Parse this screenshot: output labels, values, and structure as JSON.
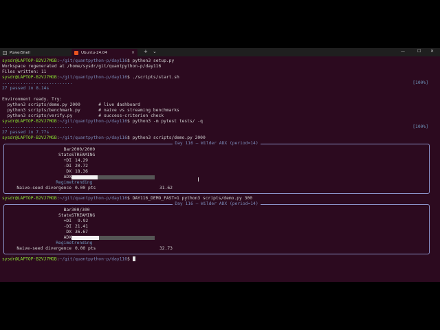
{
  "tabs": [
    {
      "label": "PowerShell",
      "active": false
    },
    {
      "label": "Ubuntu-24.04",
      "active": true
    }
  ],
  "tab_controls": {
    "close": "×",
    "new": "+",
    "menu": "⌄"
  },
  "window_controls": {
    "minimize": "—",
    "maximize": "☐",
    "close": "✕"
  },
  "prompt": {
    "user": "sysdr@LAPTOP-B2VJ7MGB",
    "sep": ":",
    "path": "~/git/quantpython-p/day116",
    "dollar": "$"
  },
  "lines": {
    "cmd1": "python3 setup.py",
    "out1": "Workspace regenerated at /home/sysdr/git/quantpython-p/day116",
    "out2": "Files written: 11",
    "cmd2": "./scripts/start.sh",
    "dots1": "...........................",
    "pct1": "[100%]",
    "pass1": "27 passed in 8.14s",
    "ready": "Environment ready. Try:",
    "try1": "  python3 scripts/demo.py 2000       # live dashboard",
    "try2": "  python3 scripts/benchmark.py       # naive vs streaming benchmarks",
    "try3": "  python3 scripts/verify.py          # success-criterion check",
    "cmd3": "python3 -m pytest tests/ -q",
    "dots2": "...........................",
    "pct2": "[100%]",
    "pass2": "27 passed in 7.77s",
    "cmd4": "python3 scripts/demo.py 2000",
    "cmd5": "DAY116_DEMO_FAST=1 python3 scripts/demo.py 300"
  },
  "panel1": {
    "title": "Day 116 — Wilder ADX (period=14)",
    "labels": {
      "bar": "Bar",
      "state": "State",
      "pdi": "+DI",
      "mdi": "-DI",
      "dx": "DX",
      "adx": "ADX",
      "regime": "Regime",
      "div": "Naive-seed divergence"
    },
    "bar": "2000/2000",
    "state": "STREAMING",
    "pdi": "14.29",
    "mdi": "20.72",
    "dx": "18.36",
    "adx": "31.62",
    "adx_fraction": 0.3162,
    "regime": "trending",
    "div": "0.00 pts"
  },
  "panel2": {
    "title": "Day 116 — Wilder ADX (period=14)",
    "labels": {
      "bar": "Bar",
      "state": "State",
      "pdi": "+DI",
      "mdi": "-DI",
      "dx": "DX",
      "adx": "ADX",
      "regime": "Regime",
      "div": "Naive-seed divergence"
    },
    "bar": "300/300",
    "state": "STREAMING",
    "pdi": "9.92",
    "mdi": "21.41",
    "dx": "36.67",
    "adx": "32.73",
    "adx_fraction": 0.3273,
    "regime": "trending",
    "div": "0.00 pts"
  },
  "colors": {
    "bg": "#2c0a1f",
    "prompt_user": "#8ae234",
    "prompt_path": "#7a8ab8",
    "accent": "#e95420"
  }
}
